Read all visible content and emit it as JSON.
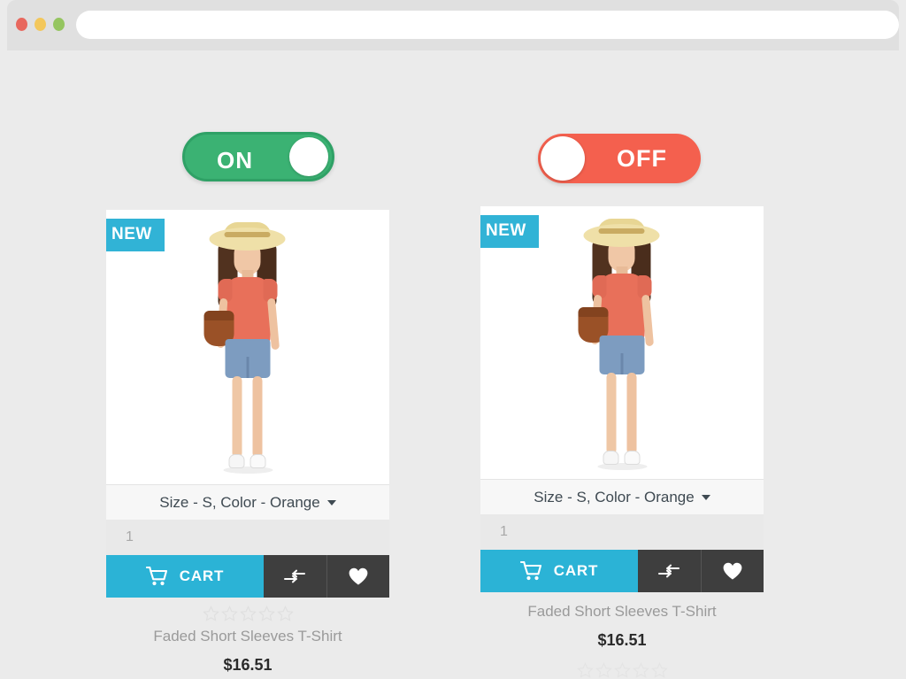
{
  "browser": {
    "traffic_lights": [
      "close",
      "minimize",
      "maximize"
    ],
    "url_value": "",
    "url_placeholder": ""
  },
  "toggles": [
    {
      "id": "on",
      "label": "ON",
      "state": "on",
      "color": "#3bb273"
    },
    {
      "id": "off",
      "label": "OFF",
      "state": "off",
      "color": "#f4604e"
    }
  ],
  "colors": {
    "accent_cyan": "#2bb3d6",
    "badge_cyan": "#31b3d6",
    "toggle_green": "#3bb273",
    "toggle_red": "#f4604e",
    "dark_button": "#3e3e3e",
    "page_background": "#ebebeb",
    "chrome_background": "#e0e0e0"
  },
  "cards": [
    {
      "badge": "NEW",
      "variant": "Size - S, Color - Orange",
      "quantity_value": "1",
      "quantity_placeholder": "1",
      "cart_label": "CART",
      "compare_label": "",
      "wishlist_label": "",
      "rating_stars": 5,
      "rating_filled": 0,
      "name": "Faded Short Sleeves T-Shirt",
      "price": "$16.51",
      "image_alt": "Woman in straw hat, orange top and denim shorts"
    },
    {
      "badge": "NEW",
      "variant": "Size - S, Color - Orange",
      "quantity_value": "1",
      "quantity_placeholder": "1",
      "cart_label": "CART",
      "compare_label": "",
      "wishlist_label": "",
      "rating_stars": 5,
      "rating_filled": 0,
      "name": "Faded Short Sleeves T-Shirt",
      "price": "$16.51",
      "image_alt": "Woman in straw hat, orange top and denim shorts"
    }
  ]
}
